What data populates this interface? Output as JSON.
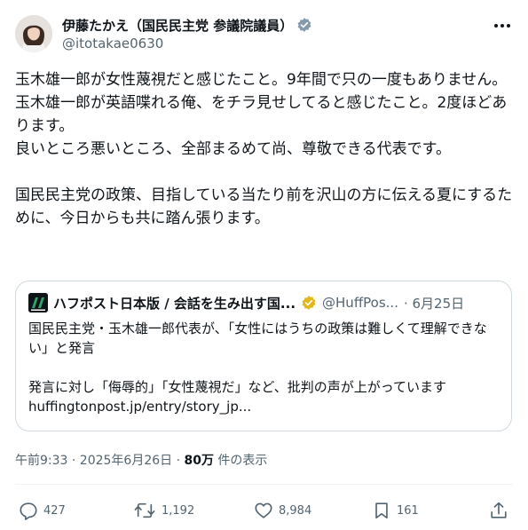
{
  "author": {
    "display_name": "伊藤たかえ（国民民主党 参議院議員）",
    "handle": "@itotakae0630"
  },
  "tweet": {
    "paragraphs": [
      "玉木雄一郎が女性蔑視だと感じたこと。9年間で只の一度もありません。",
      "玉木雄一郎が英語喋れる俺、をチラ見せしてると感じたこと。2度ほどあります。",
      "良いところ悪いところ、全部まるめて尚、尊敬できる代表です。",
      "国民民主党の政策、目指している当たり前を沢山の方に伝える夏にするために、今日からも共に踏ん張ります。"
    ]
  },
  "quote": {
    "name": "ハフポスト日本版 / 会話を生み出す国...",
    "handle": "@HuffPos...",
    "date": "· 6月25日",
    "line1": "国民民主党・玉木雄一郎代表が、「女性にはうちの政策は難しくて理解できない」と発言",
    "line2": "発言に対し「侮辱的」「女性蔑視だ」など、批判の声が上がっています huffingtonpost.jp/entry/story_jp..."
  },
  "meta": {
    "time_date": "午前9:33 · 2025年6月26日 · ",
    "views_count": "80万",
    "views_label": " 件の表示"
  },
  "actions": {
    "replies": "427",
    "reposts": "1,192",
    "likes": "8,984",
    "bookmarks": "161"
  },
  "colors": {
    "text": "#0f1419",
    "secondary": "#536471",
    "border": "#cfd9de",
    "verified_gray": "#829aab",
    "verified_gold": "#e2b719"
  },
  "icons": [
    "verified-badge-icon",
    "more-icon",
    "huffpost-logo-icon",
    "gold-verified-badge-icon",
    "reply-icon",
    "repost-icon",
    "like-icon",
    "bookmark-icon",
    "share-icon"
  ]
}
